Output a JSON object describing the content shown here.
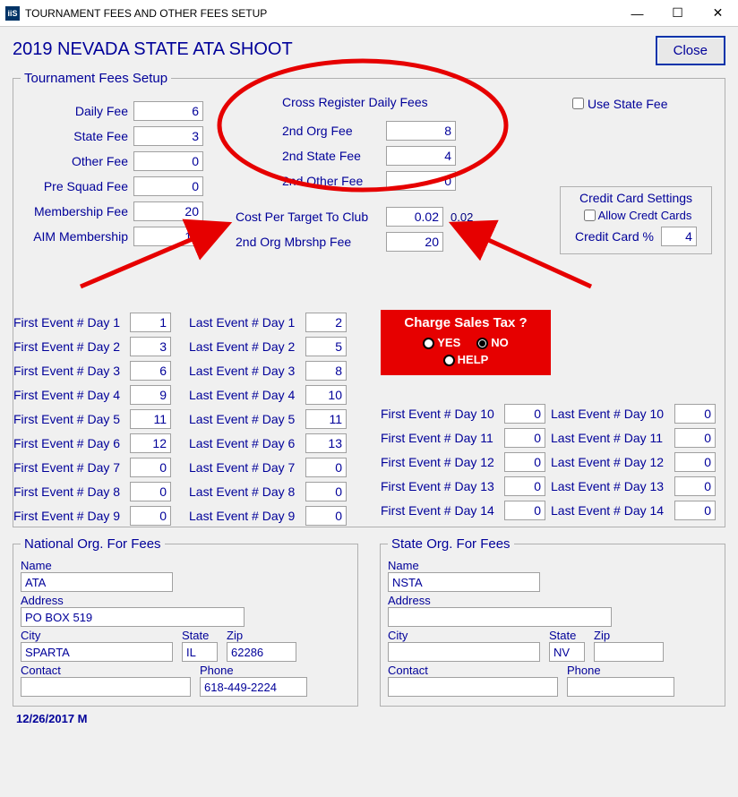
{
  "window": {
    "title": "TOURNAMENT FEES AND OTHER FEES SETUP",
    "app_icon_text": "iiS"
  },
  "header": {
    "event_title": "2019 NEVADA STATE ATA SHOOT",
    "close_label": "Close"
  },
  "fees": {
    "legend": "Tournament Fees Setup",
    "daily_fee": {
      "label": "Daily Fee",
      "value": "6"
    },
    "state_fee": {
      "label": "State Fee",
      "value": "3"
    },
    "other_fee": {
      "label": "Other Fee",
      "value": "0"
    },
    "pre_squad": {
      "label": "Pre Squad Fee",
      "value": "0"
    },
    "membership": {
      "label": "Membership Fee",
      "value": "20"
    },
    "aim": {
      "label": "AIM Membership",
      "value": "12"
    },
    "cross_heading": "Cross Register Daily Fees",
    "cross_2nd_org": {
      "label": "2nd Org Fee",
      "value": "8"
    },
    "cross_2nd_state": {
      "label": "2nd State Fee",
      "value": "4"
    },
    "cross_2nd_other": {
      "label": "2nd Other Fee",
      "value": "0"
    },
    "use_state_fee_label": "Use State Fee",
    "cost_per_target": {
      "label": "Cost Per Target To Club",
      "value": "0.02",
      "display": "0.02"
    },
    "second_org_mbrshp": {
      "label": "2nd Org Mbrshp Fee",
      "value": "20"
    },
    "credit": {
      "title": "Credit Card Settings",
      "allow_label": "Allow Credt Cards",
      "pct_label": "Credit Card %",
      "pct_value": "4"
    },
    "tax": {
      "title": "Charge Sales Tax ?",
      "yes": "YES",
      "no": "NO",
      "help": "HELP",
      "selected": "NO"
    }
  },
  "days": {
    "first_label_prefix": "First Event # Day ",
    "last_label_prefix": "Last Event # Day ",
    "first": [
      "1",
      "3",
      "6",
      "9",
      "11",
      "12",
      "0",
      "0",
      "0",
      "0",
      "0",
      "0",
      "0",
      "0"
    ],
    "last": [
      "2",
      "5",
      "8",
      "10",
      "11",
      "13",
      "0",
      "0",
      "0",
      "0",
      "0",
      "0",
      "0",
      "0"
    ]
  },
  "national_org": {
    "legend": "National Org. For Fees",
    "name_label": "Name",
    "name": "ATA",
    "address_label": "Address",
    "address": "PO BOX 519",
    "city_label": "City",
    "city": "SPARTA",
    "state_label": "State",
    "state": "IL",
    "zip_label": "Zip",
    "zip": "62286",
    "contact_label": "Contact",
    "contact": "",
    "phone_label": "Phone",
    "phone": "618-449-2224"
  },
  "state_org": {
    "legend": "State Org. For Fees",
    "name_label": "Name",
    "name": "NSTA",
    "address_label": "Address",
    "address": "",
    "city_label": "City",
    "city": "",
    "state_label": "State",
    "state": "NV",
    "zip_label": "Zip",
    "zip": "",
    "contact_label": "Contact",
    "contact": "",
    "phone_label": "Phone",
    "phone": ""
  },
  "footer": {
    "date": "12/26/2017 M"
  }
}
